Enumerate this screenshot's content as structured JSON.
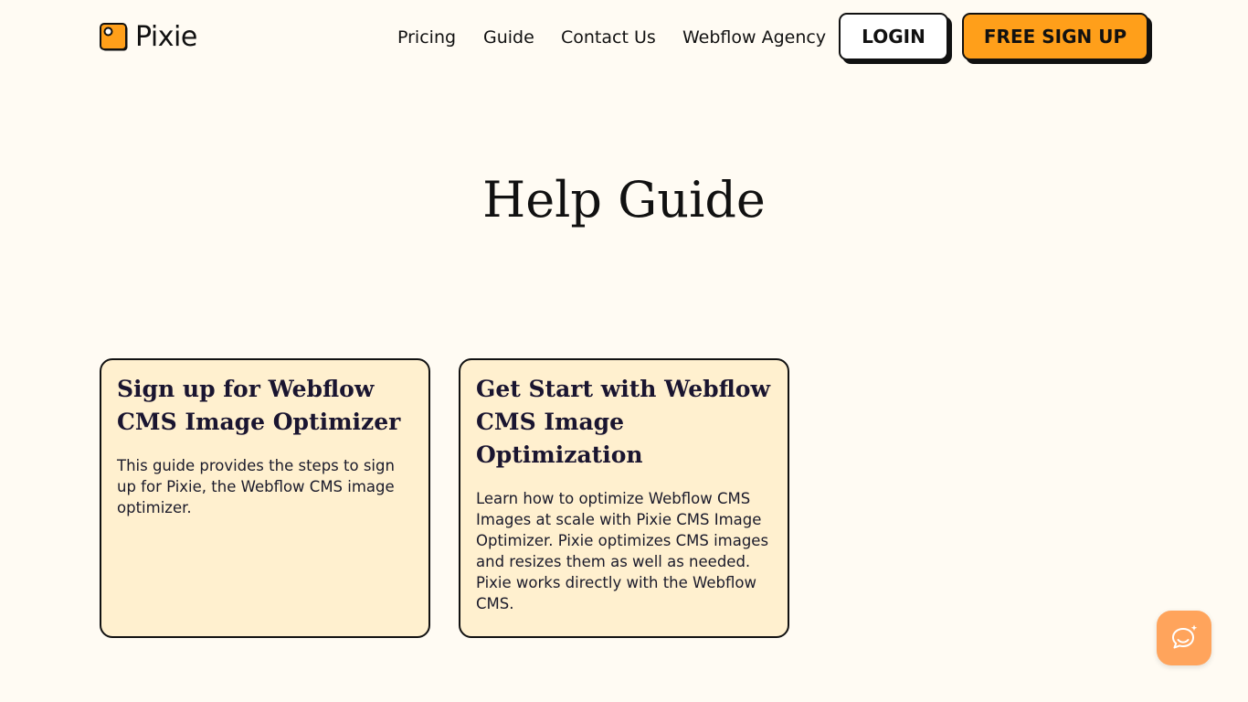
{
  "brand": {
    "name": "Pixie",
    "accent_color": "#ff9f1a",
    "logo_icon": "pixie-logo-icon"
  },
  "nav": {
    "items": [
      {
        "label": "Pricing"
      },
      {
        "label": "Guide"
      },
      {
        "label": "Contact Us"
      },
      {
        "label": "Webflow Agency"
      }
    ],
    "login_label": "LOGIN",
    "signup_label": "FREE SIGN UP"
  },
  "hero": {
    "title": "Help Guide"
  },
  "cards": [
    {
      "title": "Sign up for Webflow CMS Image Optimizer",
      "description": "This guide provides the steps to sign up for Pixie, the Webflow CMS image optimizer."
    },
    {
      "title": "Get Start with Webflow CMS Image Optimization",
      "description": "Learn how to optimize Webflow CMS Images at scale with Pixie CMS Image Optimizer. Pixie optimizes CMS images and resizes them as well as needed. Pixie works directly with the Webflow CMS."
    }
  ],
  "chat_widget": {
    "icon": "chat-sparkle-icon",
    "color": "#ffa45c"
  }
}
